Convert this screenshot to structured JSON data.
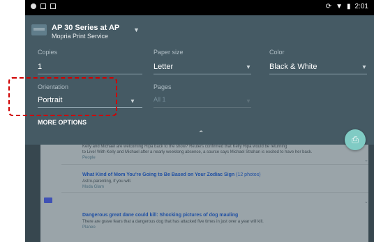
{
  "status_bar": {
    "time": "2:01"
  },
  "printer": {
    "name": "AP 30 Series at AP",
    "service": "Mopria Print Service"
  },
  "settings": {
    "copies": {
      "label": "Copies",
      "value": "1"
    },
    "paper_size": {
      "label": "Paper size",
      "value": "Letter"
    },
    "color": {
      "label": "Color",
      "value": "Black & White"
    },
    "orientation": {
      "label": "Orientation",
      "value": "Portrait"
    },
    "pages": {
      "label": "Pages",
      "value": "All 1"
    }
  },
  "more_options": "MORE OPTIONS",
  "preview": {
    "top_lines": [
      "Kelly and Michael are welcoming Ripa back to the show? Reuters confirmed that Kelly Ripa would be returning",
      "to Live! With Kelly and Michael after a nearly weeklong absence, a source says Michael Strahan is excited to have her back.",
      "People"
    ],
    "articles": [
      {
        "title": "What Kind of Mom You're Going to Be Based on Your Zodiac Sign",
        "tag": "(12 photos)",
        "snippet": "Astro-parenting, if you will.",
        "source": "Moda Glam"
      },
      {
        "title": "Dangerous great dane could kill: Shocking pictures of dog mauling",
        "tag": "",
        "snippet": "There are grave fears that a dangerous dog that has attacked five times in just over a year will kill.",
        "source": "Planeo"
      }
    ]
  },
  "colors": {
    "panel": "#455a64",
    "fab": "#80cbc4",
    "highlight": "#d00000",
    "link": "#1f4fa3"
  }
}
